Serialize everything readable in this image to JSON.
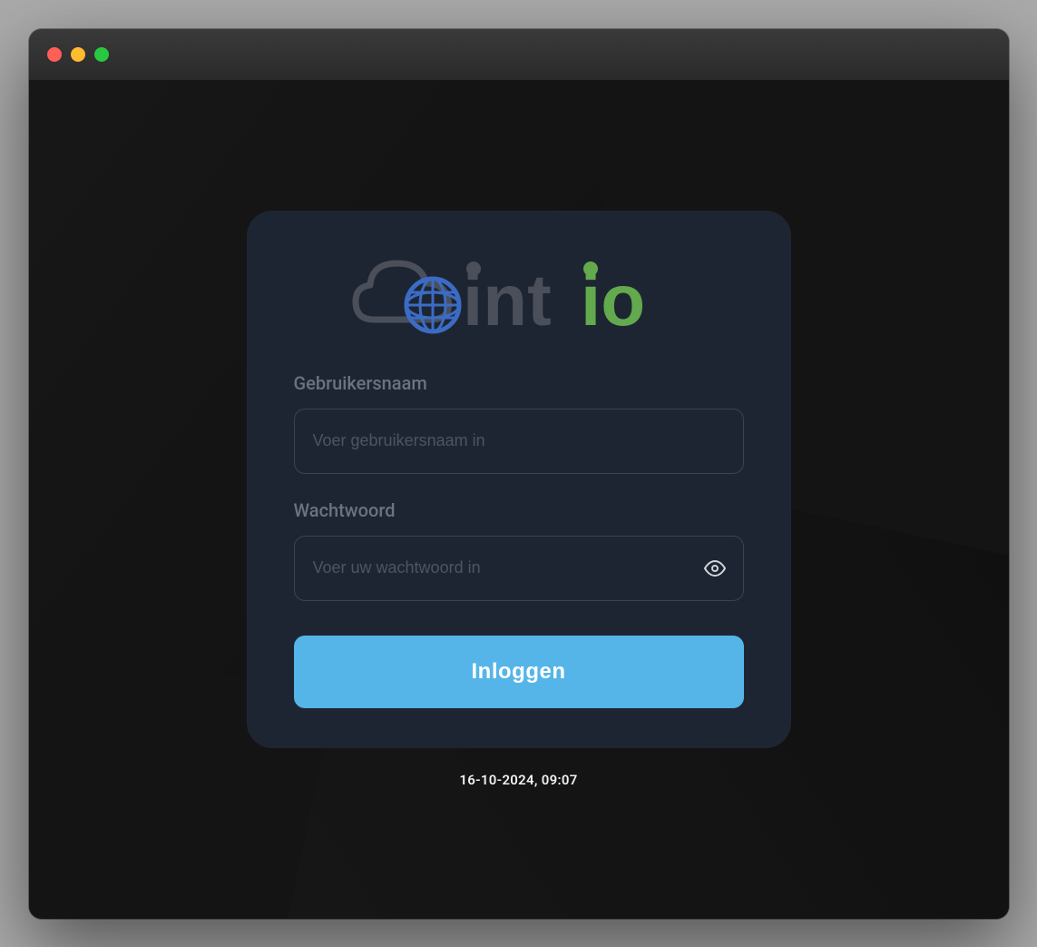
{
  "logo": {
    "text_dark": "int",
    "text_green": "io",
    "colors": {
      "cloud": "#4a4f5a",
      "globe": "#3b6cc5",
      "text_dark": "#4a4f5a",
      "text_green": "#63a94e"
    }
  },
  "form": {
    "username": {
      "label": "Gebruikersnaam",
      "placeholder": "Voer gebruikersnaam in"
    },
    "password": {
      "label": "Wachtwoord",
      "placeholder": "Voer uw wachtwoord in"
    },
    "submit_label": "Inloggen"
  },
  "footer": {
    "timestamp": "16-10-2024, 09:07"
  },
  "colors": {
    "card_bg": "#1e2532",
    "button_bg": "#55b5e8",
    "label": "#6b7280",
    "border": "#3a4352"
  }
}
